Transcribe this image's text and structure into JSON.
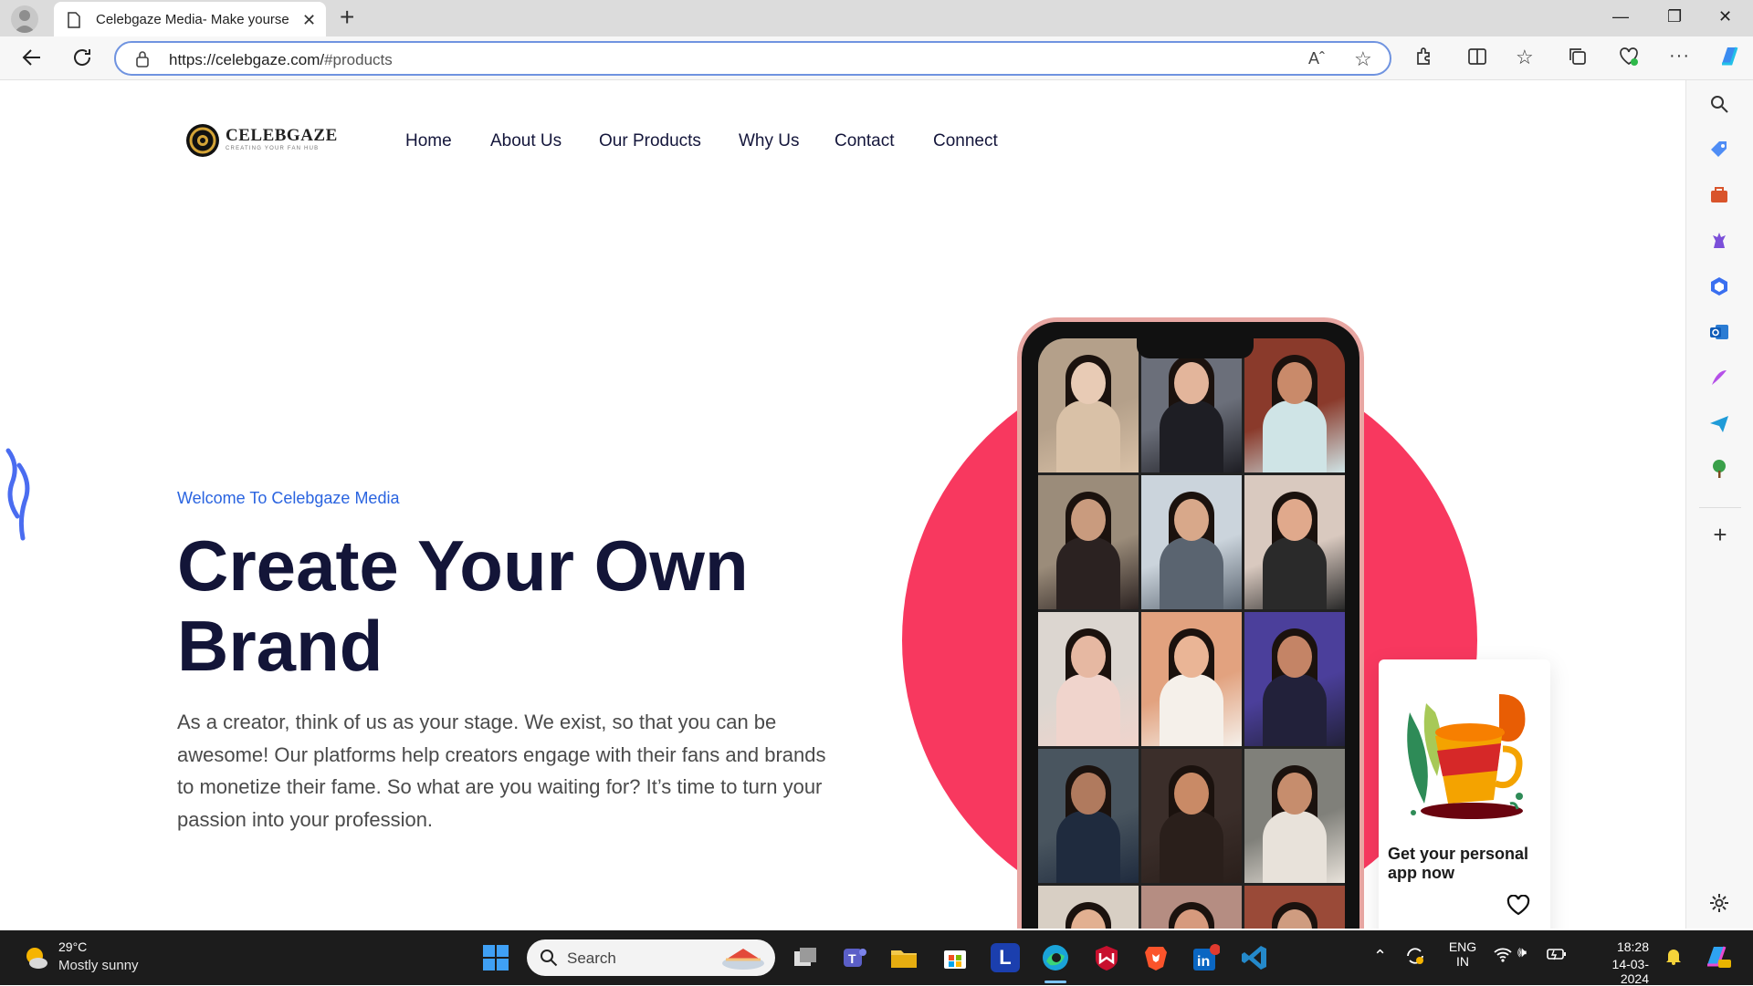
{
  "browser": {
    "tab_title": "Celebgaze Media- Make yourself",
    "url_host": "https://celebgaze.com/",
    "url_path": "#products"
  },
  "site": {
    "logo_text": "CELEBGAZE",
    "logo_subtitle": "CREATING YOUR FAN HUB",
    "nav": [
      "Home",
      "About Us",
      "Our Products",
      "Why Us",
      "Contact",
      "Connect"
    ],
    "eyebrow": "Welcome To Celebgaze Media",
    "headline_line1": "Create Your Own",
    "headline_line2": "Brand",
    "description": "As a creator, think of us as your stage. We exist, so that you can be awesome! Our platforms help creators engage with their fans and brands to monetize their fame. So what are you waiting for? It’s time to turn your passion into your profession.",
    "app_card_title": "Get your personal app now",
    "accent_color": "#f8385f",
    "heading_color": "#131538",
    "eyebrow_color": "#2a64e0"
  },
  "taskbar": {
    "weather_temp": "29°C",
    "weather_text": "Mostly sunny",
    "search_label": "Search",
    "lang_top": "ENG",
    "lang_bottom": "IN",
    "time": "18:28",
    "date": "14-03-2024"
  }
}
